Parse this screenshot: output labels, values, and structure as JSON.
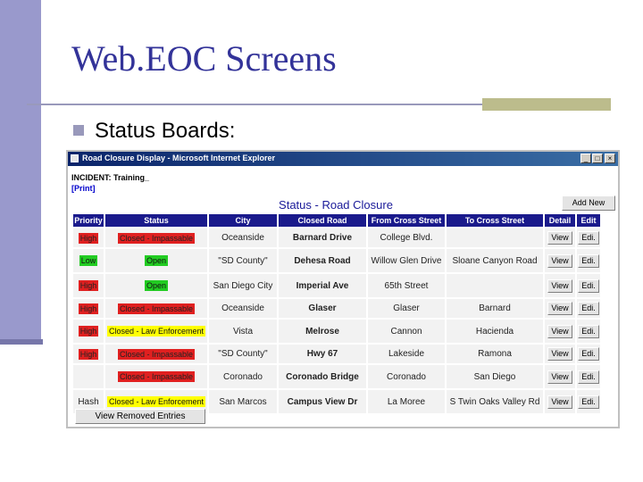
{
  "slide": {
    "title": "Web.EOC Screens",
    "bullet": "Status Boards:"
  },
  "window": {
    "title": "Road Closure Display - Microsoft Internet Explorer",
    "controls": {
      "minimize": "_",
      "maximize": "□",
      "close": "×"
    }
  },
  "page": {
    "incident": "INCIDENT: Training_",
    "print_link": "[Print]",
    "board_title": "Status - Road Closure",
    "add_new_label": "Add New",
    "view_removed_label": "View Removed Entries"
  },
  "colors": {
    "header_bg": "#1a1a8c",
    "high": "#e02020",
    "low_open": "#22cc22",
    "law": "#ffff00"
  },
  "table": {
    "headers": [
      "Priority",
      "Status",
      "City",
      "Closed Road",
      "From Cross Street",
      "To Cross Street",
      "Detail",
      "Edit"
    ],
    "rows": [
      {
        "priority": "High",
        "priority_color": "red",
        "status": "Closed - Impassable",
        "status_color": "red",
        "city": "Oceanside",
        "road": "Barnard Drive",
        "from": "College Blvd.",
        "to": "",
        "detail": "View",
        "edit": "Edi."
      },
      {
        "priority": "Low",
        "priority_color": "green",
        "status": "Open",
        "status_color": "green",
        "city": "\"SD County\"",
        "road": "Dehesa Road",
        "from": "Willow Glen Drive",
        "to": "Sloane Canyon Road",
        "detail": "View",
        "edit": "Edi."
      },
      {
        "priority": "High",
        "priority_color": "red",
        "status": "Open",
        "status_color": "green",
        "city": "San Diego City",
        "road": "Imperial Ave",
        "from": "65th Street",
        "to": "",
        "detail": "View",
        "edit": "Edi."
      },
      {
        "priority": "High",
        "priority_color": "red",
        "status": "Closed - Impassable",
        "status_color": "red",
        "city": "Oceanside",
        "road": "Glaser",
        "from": "Glaser",
        "to": "Barnard",
        "detail": "View",
        "edit": "Edi."
      },
      {
        "priority": "High",
        "priority_color": "red",
        "status": "Closed - Law Enforcement",
        "status_color": "yellow",
        "city": "Vista",
        "road": "Melrose",
        "from": "Cannon",
        "to": "Hacienda",
        "detail": "View",
        "edit": "Edi."
      },
      {
        "priority": "High",
        "priority_color": "red",
        "status": "Closed - Impassable",
        "status_color": "red",
        "city": "\"SD County\"",
        "road": "Hwy 67",
        "from": "Lakeside",
        "to": "Ramona",
        "detail": "View",
        "edit": "Edi."
      },
      {
        "priority": "",
        "priority_color": "",
        "status": "Closed - Impassable",
        "status_color": "red",
        "city": "Coronado",
        "road": "Coronado Bridge",
        "from": "Coronado",
        "to": "San Diego",
        "detail": "View",
        "edit": "Edi."
      },
      {
        "priority": "Hash",
        "priority_color": "",
        "status": "Closed - Law Enforcement",
        "status_color": "yellow",
        "city": "San Marcos",
        "road": "Campus View Dr",
        "from": "La Moree",
        "to": "S Twin Oaks Valley Rd",
        "detail": "View",
        "edit": "Edi."
      }
    ]
  }
}
